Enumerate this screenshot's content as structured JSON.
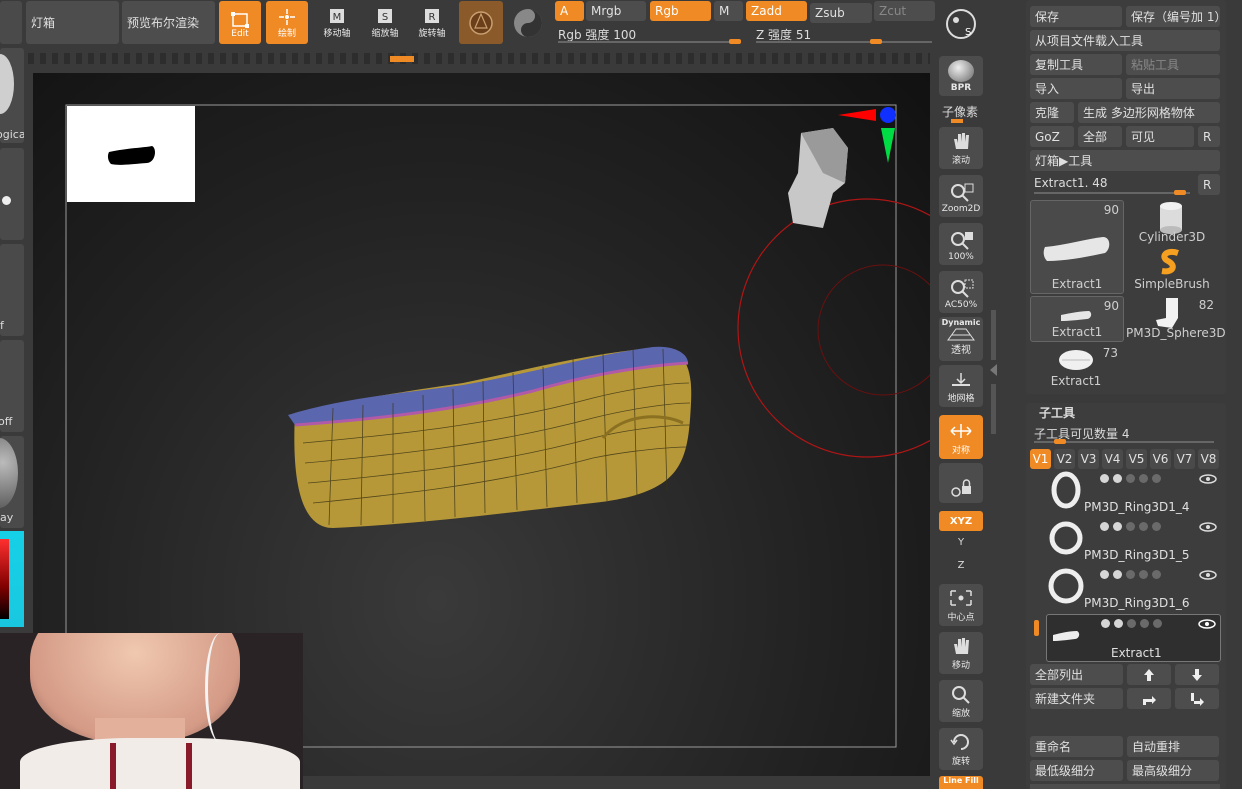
{
  "toolbar": {
    "lightbox": "灯箱",
    "preview_bpr": "预览布尔渲染",
    "edit": "Edit",
    "draw": "绘制",
    "move": "移动轴",
    "scale": "缩放轴",
    "rotate": "旋转轴",
    "a": "A",
    "mrgb": "Mrgb",
    "rgb": "Rgb",
    "m": "M",
    "zadd": "Zadd",
    "zsub": "Zsub",
    "zcut": "Zcut",
    "rgb_intensity": "Rgb 强度 100",
    "z_intensity": "Z 强度 51",
    "rgb_intensity_value": 100,
    "z_intensity_value": 51
  },
  "left_shelf": {
    "logical": "ogica",
    "f": "f",
    "off": "off",
    "ray": "ay"
  },
  "side_shelf": {
    "bpr": "BPR",
    "subpixel": "子像素",
    "scroll": "滚动",
    "zoom2d": "Zoom2D",
    "pct100": "100%",
    "ac50": "AC50%",
    "dynamic": "Dynamic",
    "perspective": "透视",
    "floor": "地网格",
    "symmetry": "对称",
    "xyz": "XYZ",
    "y": "Y",
    "z": "Z",
    "center": "中心点",
    "move": "移动",
    "zoom": "缩放",
    "rotate": "旋转",
    "linefill": "Line Fill"
  },
  "tool_panel": {
    "save": "保存",
    "save_increment": "保存（编号加 1）",
    "load_from_project": "从项目文件载入工具",
    "copy_tool": "复制工具",
    "paste_tool": "粘贴工具",
    "import": "导入",
    "export": "导出",
    "clone": "克隆",
    "make_polymesh": "生成 多边形网格物体",
    "goz": "GoZ",
    "all": "全部",
    "visible": "可见",
    "r": "R",
    "lightbox_tools": "灯箱▶工具",
    "current_tool": "Extract1. 48",
    "current_tool_value": 48,
    "thumbs": [
      {
        "label": "Extract1",
        "count": "90"
      },
      {
        "label": "Cylinder3D",
        "count": ""
      },
      {
        "label": "SimpleBrush",
        "count": ""
      },
      {
        "label": "Extract1",
        "count": "90"
      },
      {
        "label": "PM3D_Sphere3D",
        "count": "82"
      },
      {
        "label": "Extract1",
        "count": "73"
      }
    ]
  },
  "subtool": {
    "title": "子工具",
    "visible_count": "子工具可见数量 4",
    "visible_count_value": 4,
    "tabs": [
      "V1",
      "V2",
      "V3",
      "V4",
      "V5",
      "V6",
      "V7",
      "V8"
    ],
    "items": [
      {
        "name": "PM3D_Ring3D1_4"
      },
      {
        "name": "PM3D_Ring3D1_5"
      },
      {
        "name": "PM3D_Ring3D1_6"
      },
      {
        "name": "Extract1"
      }
    ],
    "list_all": "全部列出",
    "new_folder": "新建文件夹",
    "rename": "重命名",
    "auto_reorder": "自动重排",
    "lowest_subdiv": "最低级细分",
    "highest_subdiv": "最高级细分"
  },
  "colors": {
    "accent": "#f08a24",
    "panel": "#3a3a3a",
    "button": "#4d4d4d",
    "canvas": "#1c1c1c",
    "mesh_yellow": "#b89a3a",
    "mesh_blue": "#5a68b0"
  }
}
